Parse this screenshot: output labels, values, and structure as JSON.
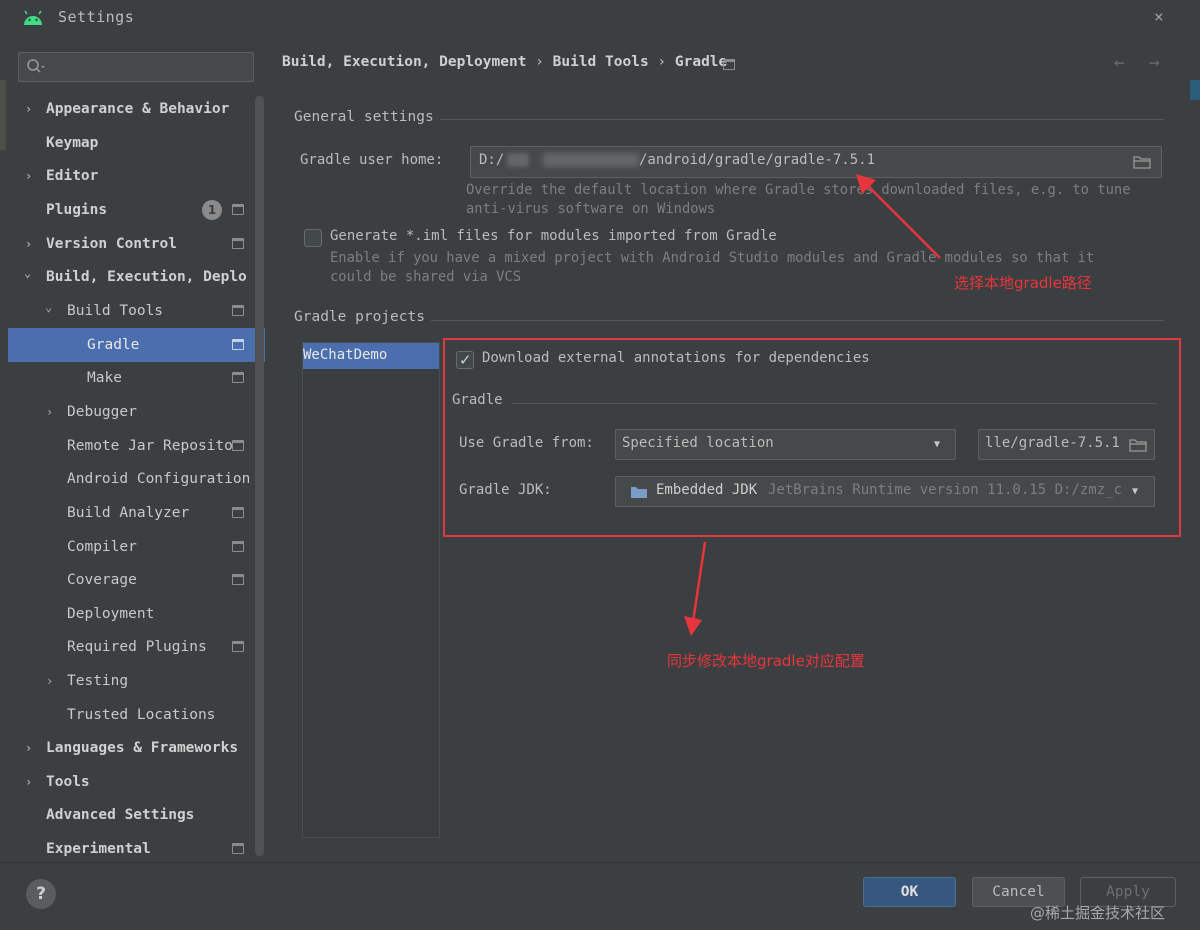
{
  "window": {
    "title": "Settings",
    "close_label": "×"
  },
  "sidebar": {
    "search_placeholder": "",
    "items": [
      {
        "label": "Appearance & Behavior",
        "arrow": "›"
      },
      {
        "label": "Keymap"
      },
      {
        "label": "Editor",
        "arrow": "›"
      },
      {
        "label": "Plugins",
        "badge": "1"
      },
      {
        "label": "Version Control",
        "arrow": "›"
      },
      {
        "label": "Build, Execution, Deplo",
        "arrow": "⌄"
      },
      {
        "label": "Build Tools",
        "arrow": "⌄"
      },
      {
        "label": "Gradle"
      },
      {
        "label": "Make"
      },
      {
        "label": "Debugger",
        "arrow": "›"
      },
      {
        "label": "Remote Jar Reposito"
      },
      {
        "label": "Android Configuration"
      },
      {
        "label": "Build Analyzer"
      },
      {
        "label": "Compiler"
      },
      {
        "label": "Coverage"
      },
      {
        "label": "Deployment"
      },
      {
        "label": "Required Plugins"
      },
      {
        "label": "Testing",
        "arrow": "›"
      },
      {
        "label": "Trusted Locations"
      },
      {
        "label": "Languages & Frameworks",
        "arrow": "›"
      },
      {
        "label": "Tools",
        "arrow": "›"
      },
      {
        "label": "Advanced Settings"
      },
      {
        "label": "Experimental"
      }
    ]
  },
  "breadcrumb": {
    "part1": "Build, Execution, Deployment",
    "part2": "Build Tools",
    "part3": "Gradle",
    "sep": "›"
  },
  "nav_arrows": {
    "back": "←",
    "forward": "→"
  },
  "general": {
    "title": "General settings",
    "user_home_label": "Gradle user home:",
    "user_home_prefix": "D:/",
    "user_home_suffix": "/android/gradle/gradle-7.5.1",
    "user_home_hint_1": "Override the default location where Gradle stores downloaded files, e.g. to tune",
    "user_home_hint_2": "anti-virus software on Windows",
    "iml_label": "Generate *.iml files for modules imported from Gradle",
    "iml_hint_1": "Enable if you have a mixed project with Android Studio modules and Gradle modules so that it",
    "iml_hint_2": "could be shared via VCS"
  },
  "projects": {
    "title": "Gradle projects",
    "list": [
      "WeChatDemo"
    ],
    "download_annotations_label": "Download external annotations for dependencies",
    "gradle_group_title": "Gradle",
    "use_gradle_from_label": "Use Gradle from:",
    "use_gradle_from_value": "Specified location",
    "gradle_location_value": "lle/gradle-7.5.1",
    "jdk_label": "Gradle JDK:",
    "jdk_name": "Embedded JDK",
    "jdk_detail": "JetBrains Runtime version 11.0.15 D:/zmz_c"
  },
  "annotations": {
    "top": "选择本地gradle路径",
    "bottom": "同步修改本地gradle对应配置"
  },
  "footer": {
    "help": "?",
    "ok": "OK",
    "cancel": "Cancel",
    "apply": "Apply",
    "watermark": "@稀土掘金技术社区"
  },
  "colors": {
    "background": "#3c3f41",
    "selection": "#4b6eaf",
    "annotation_red": "#e0393e",
    "ok_button": "#365880"
  }
}
